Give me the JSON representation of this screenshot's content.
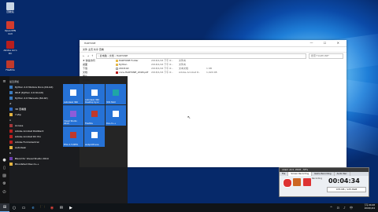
{
  "desktop": {
    "icons": [
      {
        "label": "回收站",
        "color": "#c9d6e6"
      },
      {
        "label": "OpenVPN GUI",
        "color": "#d23b2e"
      },
      {
        "label": "Adobe Acro DC",
        "color": "#b81e1e"
      },
      {
        "label": "FileZilla",
        "color": "#c0392b"
      }
    ]
  },
  "explorer": {
    "title": "HARTUNE",
    "window_controls": "—  ☐  ✕",
    "ribbon": "文件  主页  共享  查看",
    "breadcrumb": "› 此电脑 › 文档 › HARTUNE",
    "search_placeholder": "搜索\"HARTUNE\"",
    "nav": [
      "★ 快速访问",
      "桌面",
      "下载",
      "文档",
      "图片",
      "此电脑",
      "网络"
    ],
    "files": [
      {
        "name": "HARTUNE Folder",
        "date": "2018/1/24 下午 6:..",
        "type": "文件夹",
        "size": ""
      },
      {
        "name": "Python",
        "date": "2018/1/24 下午 6:..",
        "type": "文件夹",
        "size": ""
      },
      {
        "name": "2018.txt",
        "date": "2018/1/24 下午 6:..",
        "type": "文本文档",
        "size": "1 KB"
      },
      {
        "name": "cons.HARTUNE_2018.pdf",
        "date": "2018/1/24 下午 6:..",
        "type": "Adobe Acrobat D..",
        "size": "1,024 KB"
      }
    ]
  },
  "start_menu": {
    "section_recent": "最近添加",
    "apps": [
      {
        "label": "Python 2.6 Module Docs (64-bit)",
        "color": "#3b7bbf"
      },
      {
        "label": "IDLE (Python 2.6 64-bit)",
        "color": "#3b7bbf"
      },
      {
        "label": "Python 2.6 Manuals (64-bit)",
        "color": "#3b7bbf"
      },
      {
        "label": "#",
        "color": ""
      },
      {
        "label": "3D 查看器",
        "color": "#2d6ac7"
      },
      {
        "label": "7-Zip",
        "color": "#e3b341"
      },
      {
        "label": "A",
        "color": ""
      },
      {
        "label": "Access",
        "color": "#a4373a"
      },
      {
        "label": "Adobe Acrobat DistillerX",
        "color": "#b81e1e"
      },
      {
        "label": "Adobe Acrobat DC Pro",
        "color": "#b81e1e"
      },
      {
        "label": "Adobe FormsCentral",
        "color": "#b81e1e"
      },
      {
        "label": "Autodesk",
        "color": "#e3b341"
      },
      {
        "label": "B",
        "color": ""
      },
      {
        "label": "Blend for Visual Studio 2019",
        "color": "#6c3fb0"
      },
      {
        "label": "Bloodshed Dev-C++",
        "color": "#e3b341"
      }
    ],
    "tiles": [
      {
        "label": "Autodesk 360",
        "color": "#2672d6",
        "icon": "#ffffff"
      },
      {
        "label": "Autodesk 360 Desktop Sync",
        "color": "#2672d6",
        "icon": "#ffffff"
      },
      {
        "label": "3DS MAX",
        "color": "#2672d6",
        "icon": "#1fa6a6"
      },
      {
        "label": "Visual Studio 2019",
        "color": "#2672d6",
        "icon": "#8e5cd9"
      },
      {
        "label": "FileZilla",
        "color": "#2672d6",
        "icon": "#c0392b"
      },
      {
        "label": "Dev-C++",
        "color": "#2672d6",
        "icon": "#ffffff"
      },
      {
        "label": "EIVA 4.5 NPFA",
        "color": "#2672d6",
        "icon": "#c0392b"
      },
      {
        "label": "webplot8.exe",
        "color": "#2672d6",
        "icon": "#ffffff"
      }
    ]
  },
  "recorder": {
    "title": "oCam v4.0, 2018 - 33%",
    "tabs": [
      "File",
      "Screen Recording",
      "Game Recording",
      "Audio Rec"
    ],
    "active_tab": "Screen Recording",
    "status": "Recording",
    "time": "00:04:34",
    "size": "476 KB / 125.8GB"
  },
  "taskbar": {
    "start_icon": "⊞",
    "items": [
      "○",
      "▭",
      "e",
      "🗀",
      "◉",
      "✉",
      "▶"
    ],
    "tray_icons": "^ ⊡ ♪ 中",
    "time": "下午 06:48",
    "date": "2018/1/24"
  }
}
